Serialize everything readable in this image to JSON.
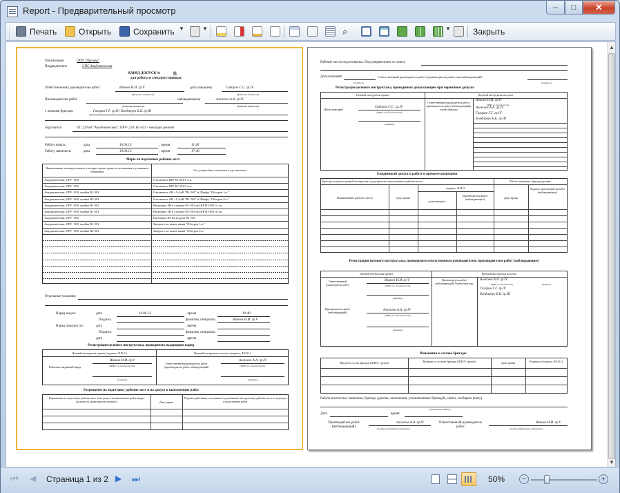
{
  "window": {
    "title": "Report - Предварительный просмотр"
  },
  "toolbar": {
    "print": "Печать",
    "open": "Открыть",
    "save": "Сохранить",
    "close": "Закрыть"
  },
  "status": {
    "page_text": "Страница 1 из 2",
    "zoom": "50%",
    "zoom_level": 0.5
  },
  "p1": {
    "org": "Организация",
    "org_v": "ООО \"Пример\"",
    "div": "Подразделение",
    "div_v": "СПС Академическая",
    "title1": "НАРЯД-ДОПУСК №",
    "title_num": "01",
    "title2": "для работы в электроустановках",
    "resp": "Ответственному руководителю работ",
    "resp_v": "Иванов И.И. гр.V",
    "admit": "допускающему",
    "admit_v": "Сидоров С.С. гр.IV",
    "prod": "Производителю работ",
    "prod_v": "",
    "watch": "наблюдающему",
    "watch_v": "Алексеев А.А. гр.IV",
    "fio1": "(фамилия, инициалы)",
    "fio2": "(фамилия, инициалы)",
    "fio3": "(фамилия, инициалы)",
    "fio4": "(фамилия, инициалы)",
    "crew": "с членами бригады",
    "crew_v": "Гагарин Г.Г. гр.IV; Бондарчук Б.Б. гр.III",
    "task": "поручается",
    "task_v": "ПС 220 кВ \"Академическая\"; ОРУ- 220; В1-501 - текущий ремонт",
    "start": "Работу начать:",
    "end": "Работу закончить:",
    "date": "дата",
    "time": ", время",
    "start_d": "10.06.13",
    "start_t": "11:40",
    "end_d": "10.06.13",
    "end_t": "17:40",
    "measures": "Меры по подготовке рабочих мест",
    "mh1": "Наименование электроустановок, в которых нужно провести отключения и установить заземления",
    "mh2": "Что должно быть отключено и где заземлено",
    "rows": [
      [
        "Академическая, ОРУ -500",
        "Отключить ШР В1-501/1 сск."
      ],
      [
        "Академическая, ОРУ -500",
        "Отключить ШР В1-501/3 сск."
      ],
      [
        "Академическая, ОРУ -500, ячейка В1-501",
        "Отключить АВ - 0,4 кВ \"В1-501\" в Шкафу \"Обогрев 1ст.\""
      ],
      [
        "Академическая, ОРУ -500, ячейка В2-501",
        "Отключить АВ - 0,4 кВ \"В1-501\" в Шкафу \"Обогрев 2ст.\""
      ],
      [
        "Академическая, ОРУ -500, ячейка В1-501",
        "Включить ЗН в сторону В1-501 на ШР В1-501/1 сск."
      ],
      [
        "Академическая, ОРУ -500, ячейка В1-501",
        "Включить ЗН в сторону В1-501 на ШР В1-501/3 сск."
      ],
      [
        "Академическая, ОРУ -500",
        "Наложить ПЗ на модули В1-501"
      ],
      [
        "Академическая, ОРУ -500, ячейка В1-501",
        "Запереть на замок шкаф \"Обогрев 1ст.\""
      ],
      [
        "Академическая, ОРУ -500, ячейка В2-501",
        "Запереть на замок шкаф \"Обогрев 2ст.\""
      ]
    ],
    "special": "Отдельные указания:",
    "issued": "Наряд выдал:",
    "extended": "Наряд продлил по:",
    "sign": "Подпись",
    "fio": "фамилия, инициалы",
    "issued_d": "10.06.13",
    "issued_t": "10:40",
    "issued_n": "Иванов И.И. гр.V",
    "reg1": "Регистрация целевого инструктажа, проводимого выдающим наряд",
    "ri1": "Целевой инструктаж провел (подпись, Ф.И.О.)",
    "ri2": "Целевой инструктаж получил (подпись, Ф.И.О.)",
    "ri3": "Работник, выдавший наряд",
    "ri4": "Ответственный руководитель работ (производитель работ, наблюдающий)",
    "ri5": "Иванов И.И. гр.V",
    "ri6": "Алексеев А.А. гр.IV",
    "ri7": "(ФИО, гр. безопасности)",
    "ri8": "(подпись)",
    "perm": "Разрешение на подготовку рабочих мест и на допуск к выполнению работ",
    "ph1": "Разрешение на подготовку рабочих мест и на допуск на выполнение работ выдал (должность, фамилия или подпись)",
    "ph2": "Дата, время",
    "ph3": "Подпись работника, получившего разрешение на подготовку рабочих мест и на допуск к выполнению работ"
  },
  "p2": {
    "h1": "Рабочие места подготовлены. Под напряжением остались",
    "h2": "Допускающий",
    "h3": "Ответственный руководитель работ (производитель работ или наблюдающий)",
    "h4": "(подпись)",
    "h5": "(подпись)",
    "reg2": "Регистрация целевого инструктажа, проводимого допускающим при первичном допуске",
    "c1": "Целевой инструктаж провел",
    "c2": "Целевой инструктаж получил",
    "c3": "Допускающий",
    "c4": "Сидоров С.С. гр.IV",
    "c5": "(ФИО, гр. безопасности)",
    "c6": "(подпись)",
    "c7": "Ответственный руководитель работ, производитель работ (наблюдающий), члены бригады",
    "c8": "Иванов И.И. гр.IV",
    "c9": "Алексеев А.А. гр.IV",
    "c10": "Гагарин Г.Г. гр.IV",
    "c11": "Бондарчук Б.Б. гр.III",
    "c12": "(ФИО, гр. безопасности)",
    "c13": "(подпись)",
    "daily": "Ежедневный допуск к работе и время ее окончания",
    "d1": "Бригада получила целевой инструктаж и допущена на подготовленное рабочее место",
    "d2": "Работа закончена, бригада удалена",
    "d3": "Наименование рабочего места",
    "d4": "Дата, время",
    "d5": "подпись, Ф.И.О.",
    "d6": "допускающего",
    "d7": "Производителя работ (наблюдающего)",
    "d8": "Дата, время",
    "d9": "Подпись производителя работ (наблюдающего)",
    "reg3": "Регистрация целевого инструктажа, проводимого ответственным руководителем, производителем работ (наблюдающим)",
    "e1": "Целевой инструктаж провел",
    "e2": "Целевой инструктаж получил",
    "e3": "Ответственный руководитель работ",
    "e4": "Иванов И.И. гр.V",
    "e5": "(ФИО, гр. безопасности)",
    "e6": "(подпись)",
    "e7": "Производитель работ (наблюдающий)",
    "e8": "Алексеев А.А. гр.IV",
    "e9": "(ФИО, гр. безопасности)",
    "e10": "(подпись)",
    "e11": "Производитель работ (наблюдающий) Члены бригады",
    "e12": "Алексеев А.А. гр.IV",
    "e13": "Гагарин Г.Г. гр.IV",
    "e14": "Бондарчук Б.Б. гр.III",
    "e15": "(ФИО, гр. безопасности)",
    "e16": "(подпись)",
    "chg": "Изменения в составе бригады",
    "g1": "Введен в состав бригады (Ф.И.О. группа)",
    "g2": "Выведен из состава бригады (Ф.И.О. группа)",
    "g3": "Дата, время",
    "g4": "Разрешил (подпись, Ф.И.О.)",
    "f1": "Работа полностью закончена, бригада удалена, заземления, установленные бригадой, сняты, сообщено (кому)",
    "f2": "(должность, Ф.И.О.)",
    "f3": "Дата",
    "f4": "время",
    "f5": "Производитель работ (наблюдающий)",
    "f6": "Алексеев А.А. гр.IV",
    "f7": "(подпись) (фамилия, инициалы)",
    "f8": "Ответственный руководитель работ",
    "f9": "Иванов И.И. гр.V",
    "f10": "(подпись) (фамилия, инициалы)"
  }
}
